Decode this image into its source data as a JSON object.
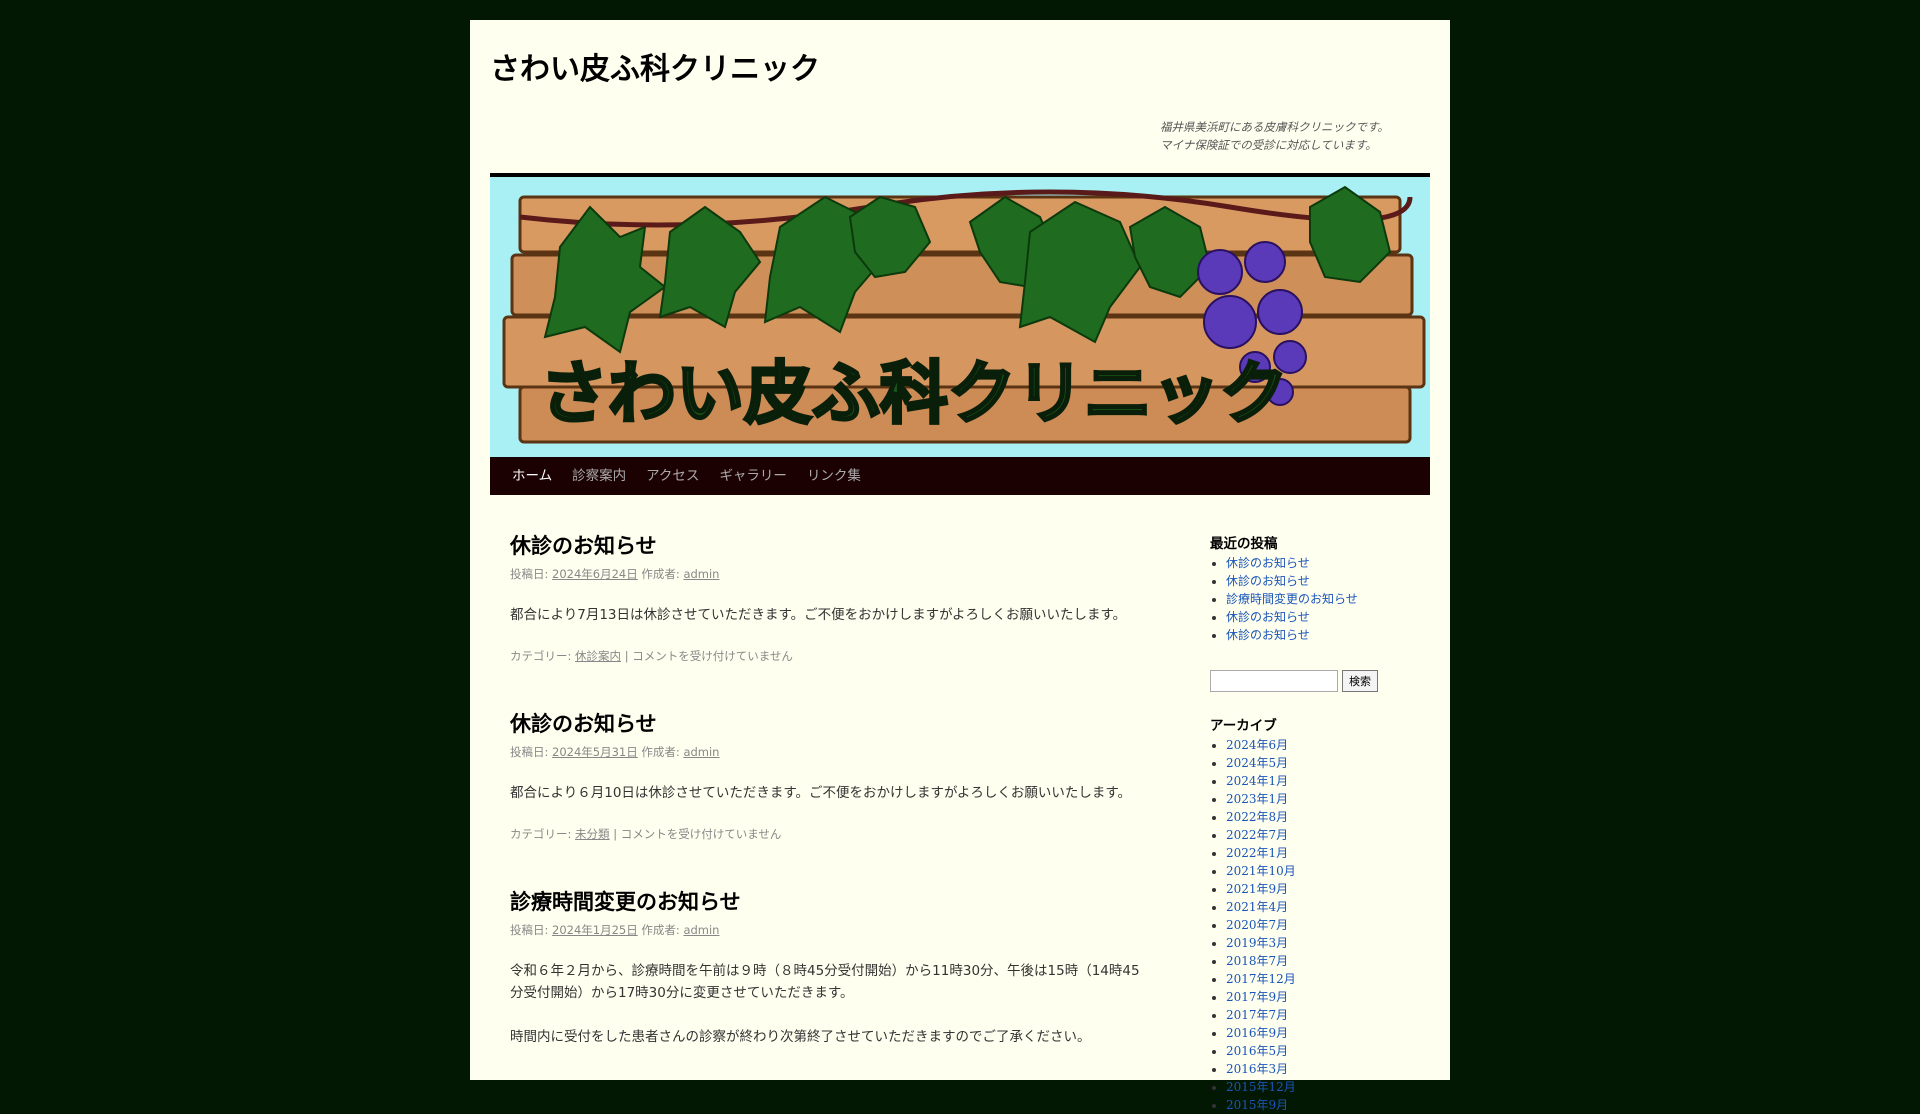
{
  "site": {
    "title": "さわい皮ふ科クリニック",
    "description_line1": "福井県美浜町にある皮膚科クリニックです。",
    "description_line2": "マイナ保険証での受診に対応しています。",
    "banner_text": "さわい皮ふ科クリニック"
  },
  "nav": {
    "items": [
      {
        "label": "ホーム"
      },
      {
        "label": "診察案内"
      },
      {
        "label": "アクセス"
      },
      {
        "label": "ギャラリー"
      },
      {
        "label": "リンク集"
      }
    ]
  },
  "posts": [
    {
      "title": "休診のお知らせ",
      "posted_label": "投稿日:",
      "date": "2024年6月24日",
      "author_label": "作成者:",
      "author": "admin",
      "body": [
        "都合により7月13日は休診させていただきます。ご不便をおかけしますがよろしくお願いいたします。"
      ],
      "category_label": "カテゴリー:",
      "category": "休診案内",
      "separator": "|",
      "comments": "コメントを受け付けていません"
    },
    {
      "title": "休診のお知らせ",
      "posted_label": "投稿日:",
      "date": "2024年5月31日",
      "author_label": "作成者:",
      "author": "admin",
      "body": [
        "都合により６月10日は休診させていただきます。ご不便をおかけしますがよろしくお願いいたします。"
      ],
      "category_label": "カテゴリー:",
      "category": "未分類",
      "separator": "|",
      "comments": "コメントを受け付けていません"
    },
    {
      "title": "診療時間変更のお知らせ",
      "posted_label": "投稿日:",
      "date": "2024年1月25日",
      "author_label": "作成者:",
      "author": "admin",
      "body": [
        "令和６年２月から、診療時間を午前は９時（８時45分受付開始）から11時30分、午後は15時（14時45分受付開始）から17時30分に変更させていただきます。",
        "時間内に受付をした患者さんの診察が終わり次第終了させていただきますのでご了承ください。"
      ]
    }
  ],
  "sidebar": {
    "recent_title": "最近の投稿",
    "recent": [
      "休診のお知らせ",
      "休診のお知らせ",
      "診療時間変更のお知らせ",
      "休診のお知らせ",
      "休診のお知らせ"
    ],
    "search_button": "検索",
    "archive_title": "アーカイブ",
    "archives": [
      "2024年6月",
      "2024年5月",
      "2024年1月",
      "2023年1月",
      "2022年8月",
      "2022年7月",
      "2022年1月",
      "2021年10月",
      "2021年9月",
      "2021年4月",
      "2020年7月",
      "2019年3月",
      "2018年7月",
      "2017年12月",
      "2017年9月",
      "2017年7月",
      "2016年9月",
      "2016年5月",
      "2016年3月",
      "2015年12月",
      "2015年9月"
    ]
  },
  "colors": {
    "page_background": "#031803",
    "content_background": "#fffff0",
    "nav_background": "#1c0103",
    "link": "#1a55b7"
  }
}
